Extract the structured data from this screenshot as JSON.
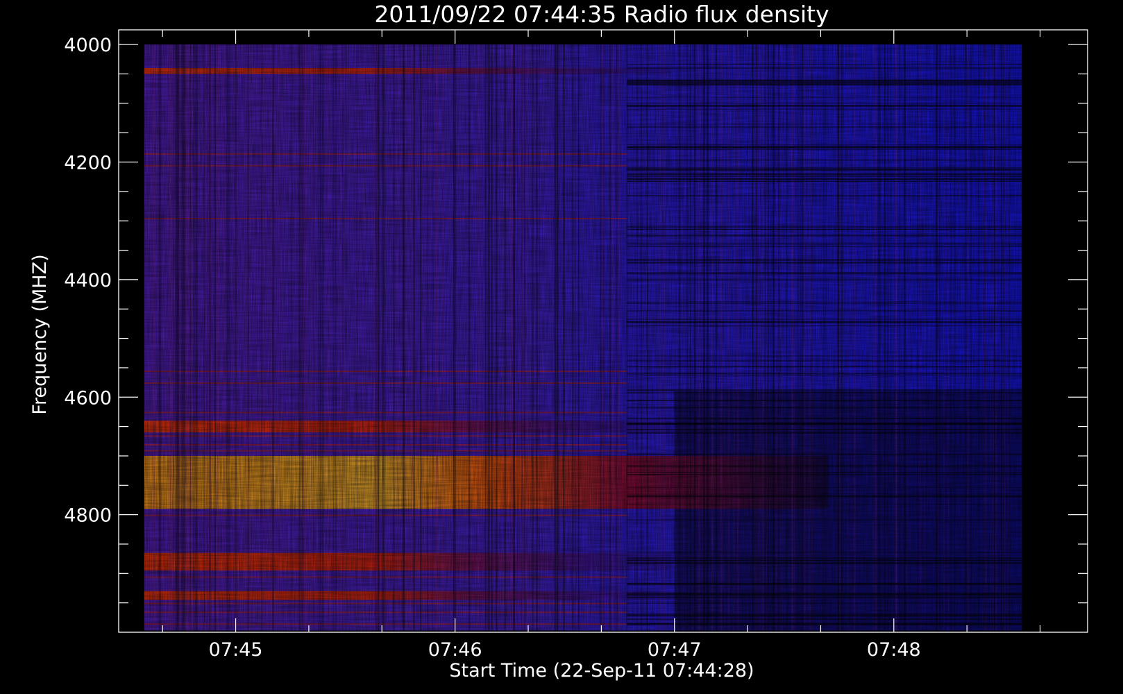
{
  "chart_data": {
    "type": "heatmap",
    "title": "2011/09/22 07:44:35 Radio flux density",
    "xlabel": "Start Time (22-Sep-11 07:44:28)",
    "ylabel": "Frequency (MHZ)",
    "x_ticks": [
      "07:45",
      "07:46",
      "07:47",
      "07:48"
    ],
    "y_ticks": [
      "4000",
      "4200",
      "4400",
      "4600",
      "4800"
    ],
    "x_range": [
      "07:44:28",
      "07:48:53"
    ],
    "y_range": [
      3975,
      5000
    ],
    "data_range_x": [
      "07:44:35",
      "07:48:35"
    ],
    "data_range_y": [
      4000,
      4997
    ],
    "y_axis_inverted": true,
    "colormap": [
      "#000000",
      "#2020f0",
      "#6a20c8",
      "#c82040",
      "#ff3a10",
      "#ffb020",
      "#ffff80"
    ],
    "background_color": "#000000",
    "axis_color": "#ffffff",
    "bright_emission_bands_mhz": [
      [
        4040,
        4050
      ],
      [
        4640,
        4660
      ],
      [
        4700,
        4790
      ],
      [
        4865,
        4895
      ],
      [
        4930,
        4945
      ]
    ],
    "quiet_time_after": "07:47:00"
  }
}
